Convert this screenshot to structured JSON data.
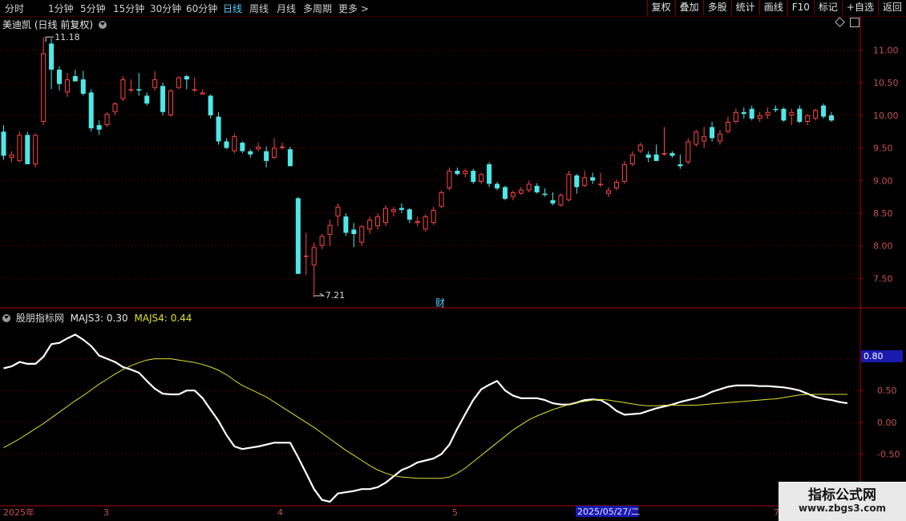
{
  "toolbar": {
    "periods": [
      "分时",
      "1分钟",
      "5分钟",
      "15分钟",
      "30分钟",
      "60分钟",
      "日线",
      "周线",
      "月线",
      "多周期",
      "更多 >"
    ],
    "active_period": "日线",
    "right_buttons": [
      "复权",
      "叠加",
      "多股",
      "统计",
      "画线",
      "F10",
      "标记",
      "+自选",
      "返回"
    ]
  },
  "colors": {
    "up": "#ff4545",
    "down": "#4fe8e8",
    "line1": "#ffffff",
    "line2": "#e0e030",
    "grid": "#7a0000",
    "axis": "#b00000"
  },
  "stock": {
    "name": "美迪凯",
    "mode": "(日线 前复权)"
  },
  "main_annotations": {
    "high_label": "11.18",
    "low_label": "7.21",
    "event_marker": "财"
  },
  "indicator": {
    "name": "股朋指标网",
    "line1_label": "MAJS3:",
    "line1_value": "0.30",
    "line2_label": "MAJS4:",
    "line2_value": "0.44",
    "cursor_value": "0.80"
  },
  "date_axis": {
    "labels": [
      "2025年",
      "3",
      "4",
      "5",
      "7"
    ],
    "cursor_date": "2025/05/27/二"
  },
  "watermark": {
    "line1": "指标公式网",
    "line2": "www.zbgs3.com"
  },
  "chart_data": [
    {
      "type": "candlestick",
      "title": "美迪凯",
      "ylim": [
        7.1,
        11.3
      ],
      "yticks": [
        7.5,
        8.0,
        8.5,
        9.0,
        9.5,
        10.0,
        10.5,
        11.0
      ],
      "grid": true,
      "ohlc": [
        [
          9.75,
          9.85,
          9.32,
          9.38
        ],
        [
          9.35,
          9.45,
          9.28,
          9.4
        ],
        [
          9.3,
          9.75,
          9.28,
          9.7
        ],
        [
          9.7,
          9.75,
          9.25,
          9.25
        ],
        [
          9.25,
          9.72,
          9.2,
          9.7
        ],
        [
          9.9,
          11.2,
          9.85,
          10.95
        ],
        [
          11.1,
          11.18,
          10.4,
          10.7
        ],
        [
          10.7,
          10.75,
          10.38,
          10.48
        ],
        [
          10.35,
          10.65,
          10.28,
          10.55
        ],
        [
          10.6,
          10.7,
          10.52,
          10.52
        ],
        [
          10.55,
          10.68,
          10.3,
          10.33
        ],
        [
          10.35,
          10.4,
          9.75,
          9.8
        ],
        [
          9.85,
          9.92,
          9.7,
          9.78
        ],
        [
          9.85,
          10.05,
          9.82,
          10.02
        ],
        [
          10.05,
          10.2,
          10.0,
          10.18
        ],
        [
          10.25,
          10.6,
          10.22,
          10.55
        ],
        [
          10.4,
          10.55,
          10.35,
          10.4
        ],
        [
          10.4,
          10.65,
          10.3,
          10.38
        ],
        [
          10.3,
          10.35,
          10.15,
          10.18
        ],
        [
          10.42,
          10.68,
          10.38,
          10.55
        ],
        [
          10.45,
          10.5,
          10.0,
          10.05
        ],
        [
          10.0,
          10.4,
          9.98,
          10.38
        ],
        [
          10.42,
          10.6,
          10.4,
          10.58
        ],
        [
          10.6,
          10.62,
          10.4,
          10.55
        ],
        [
          10.38,
          10.58,
          10.35,
          10.4
        ],
        [
          10.32,
          10.4,
          10.32,
          10.35
        ],
        [
          10.3,
          10.32,
          9.95,
          10.0
        ],
        [
          9.98,
          10.05,
          9.55,
          9.6
        ],
        [
          9.6,
          9.65,
          9.48,
          9.5
        ],
        [
          9.45,
          9.72,
          9.42,
          9.68
        ],
        [
          9.58,
          9.6,
          9.42,
          9.45
        ],
        [
          9.45,
          9.48,
          9.35,
          9.4
        ],
        [
          9.48,
          9.58,
          9.45,
          9.52
        ],
        [
          9.45,
          9.52,
          9.2,
          9.3
        ],
        [
          9.35,
          9.65,
          9.33,
          9.5
        ],
        [
          9.5,
          9.58,
          9.48,
          9.52
        ],
        [
          9.48,
          9.52,
          9.22,
          9.22
        ],
        [
          8.73,
          8.75,
          7.57,
          7.57
        ],
        [
          7.85,
          8.2,
          7.55,
          7.85
        ],
        [
          7.7,
          8.05,
          7.21,
          7.98
        ],
        [
          8.0,
          8.18,
          7.95,
          8.15
        ],
        [
          8.17,
          8.4,
          8.0,
          8.32
        ],
        [
          8.45,
          8.65,
          8.3,
          8.6
        ],
        [
          8.45,
          8.5,
          8.15,
          8.2
        ],
        [
          8.25,
          8.35,
          7.98,
          8.18
        ],
        [
          8.05,
          8.32,
          8.0,
          8.3
        ],
        [
          8.25,
          8.45,
          8.18,
          8.4
        ],
        [
          8.3,
          8.5,
          8.25,
          8.45
        ],
        [
          8.35,
          8.62,
          8.3,
          8.58
        ],
        [
          8.52,
          8.6,
          8.45,
          8.56
        ],
        [
          8.58,
          8.65,
          8.5,
          8.55
        ],
        [
          8.56,
          8.58,
          8.35,
          8.4
        ],
        [
          8.35,
          8.45,
          8.3,
          8.38
        ],
        [
          8.25,
          8.48,
          8.22,
          8.45
        ],
        [
          8.35,
          8.6,
          8.32,
          8.55
        ],
        [
          8.6,
          8.85,
          8.58,
          8.82
        ],
        [
          8.88,
          9.2,
          8.85,
          9.15
        ],
        [
          9.15,
          9.2,
          9.08,
          9.1
        ],
        [
          9.1,
          9.18,
          9.05,
          9.15
        ],
        [
          9.15,
          9.18,
          8.95,
          8.98
        ],
        [
          8.98,
          9.12,
          8.95,
          9.1
        ],
        [
          9.25,
          9.28,
          8.9,
          8.95
        ],
        [
          8.95,
          8.98,
          8.85,
          8.88
        ],
        [
          8.9,
          8.92,
          8.7,
          8.72
        ],
        [
          8.75,
          8.85,
          8.7,
          8.82
        ],
        [
          8.8,
          8.9,
          8.78,
          8.86
        ],
        [
          8.85,
          9.0,
          8.82,
          8.95
        ],
        [
          8.92,
          8.96,
          8.8,
          8.82
        ],
        [
          8.8,
          8.88,
          8.75,
          8.78
        ],
        [
          8.7,
          8.82,
          8.62,
          8.65
        ],
        [
          8.62,
          8.8,
          8.6,
          8.78
        ],
        [
          8.7,
          9.15,
          8.68,
          9.1
        ],
        [
          9.08,
          9.1,
          8.8,
          8.9
        ],
        [
          8.92,
          9.15,
          8.9,
          9.05
        ],
        [
          9.05,
          9.12,
          8.95,
          9.0
        ],
        [
          8.95,
          9.12,
          8.9,
          8.95
        ],
        [
          8.8,
          8.9,
          8.75,
          8.85
        ],
        [
          8.88,
          9.02,
          8.85,
          8.98
        ],
        [
          8.98,
          9.3,
          8.95,
          9.25
        ],
        [
          9.25,
          9.45,
          9.22,
          9.4
        ],
        [
          9.45,
          9.58,
          9.42,
          9.55
        ],
        [
          9.4,
          9.45,
          9.28,
          9.35
        ],
        [
          9.4,
          9.55,
          9.3,
          9.3
        ],
        [
          9.4,
          9.82,
          9.38,
          9.42
        ],
        [
          9.42,
          9.45,
          9.35,
          9.38
        ],
        [
          9.25,
          9.4,
          9.18,
          9.22
        ],
        [
          9.28,
          9.65,
          9.25,
          9.6
        ],
        [
          9.55,
          9.78,
          9.52,
          9.75
        ],
        [
          9.6,
          9.82,
          9.5,
          9.68
        ],
        [
          9.82,
          9.9,
          9.6,
          9.65
        ],
        [
          9.6,
          9.78,
          9.55,
          9.72
        ],
        [
          9.75,
          9.98,
          9.72,
          9.9
        ],
        [
          9.9,
          10.1,
          9.88,
          10.05
        ],
        [
          10.05,
          10.12,
          9.95,
          10.02
        ],
        [
          10.1,
          10.15,
          9.92,
          9.95
        ],
        [
          9.95,
          10.05,
          9.9,
          10.0
        ],
        [
          10.0,
          10.12,
          9.95,
          10.05
        ],
        [
          10.1,
          10.15,
          10.05,
          10.08
        ],
        [
          10.1,
          10.12,
          9.9,
          9.92
        ],
        [
          10.0,
          10.1,
          9.85,
          10.05
        ],
        [
          10.1,
          10.15,
          9.88,
          9.9
        ],
        [
          9.9,
          10.02,
          9.85,
          10.0
        ],
        [
          9.95,
          10.1,
          9.92,
          10.08
        ],
        [
          10.15,
          10.18,
          9.95,
          9.98
        ],
        [
          10.0,
          10.05,
          9.9,
          9.92
        ]
      ]
    },
    {
      "type": "line",
      "title": "股朋指标网",
      "ylim": [
        -1.3,
        1.6
      ],
      "yticks": [
        -0.5,
        0.0,
        0.5,
        1.0
      ],
      "grid": true,
      "series": [
        {
          "name": "MAJS3",
          "values": [
            0.85,
            0.88,
            0.95,
            0.92,
            0.92,
            1.03,
            1.23,
            1.25,
            1.32,
            1.38,
            1.3,
            1.2,
            1.05,
            1.0,
            0.95,
            0.87,
            0.83,
            0.78,
            0.65,
            0.53,
            0.45,
            0.44,
            0.44,
            0.5,
            0.5,
            0.38,
            0.2,
            0.02,
            -0.2,
            -0.38,
            -0.42,
            -0.4,
            -0.38,
            -0.35,
            -0.32,
            -0.32,
            -0.32,
            -0.55,
            -0.8,
            -1.05,
            -1.22,
            -1.25,
            -1.12,
            -1.1,
            -1.08,
            -1.05,
            -1.05,
            -1.02,
            -0.95,
            -0.85,
            -0.75,
            -0.7,
            -0.63,
            -0.6,
            -0.57,
            -0.5,
            -0.35,
            -0.1,
            0.13,
            0.35,
            0.52,
            0.59,
            0.65,
            0.5,
            0.42,
            0.38,
            0.38,
            0.38,
            0.35,
            0.3,
            0.28,
            0.28,
            0.31,
            0.35,
            0.36,
            0.35,
            0.28,
            0.18,
            0.12,
            0.13,
            0.14,
            0.18,
            0.22,
            0.25,
            0.28,
            0.32,
            0.35,
            0.38,
            0.42,
            0.48,
            0.52,
            0.56,
            0.58,
            0.58,
            0.58,
            0.57,
            0.57,
            0.56,
            0.55,
            0.53,
            0.5,
            0.45,
            0.4,
            0.37,
            0.35,
            0.32,
            0.3
          ]
        },
        {
          "name": "MAJS4",
          "values": [
            -0.4,
            -0.33,
            -0.26,
            -0.18,
            -0.1,
            -0.02,
            0.07,
            0.16,
            0.25,
            0.34,
            0.42,
            0.51,
            0.6,
            0.68,
            0.76,
            0.83,
            0.89,
            0.94,
            0.98,
            1.0,
            1.0,
            1.0,
            0.98,
            0.96,
            0.94,
            0.91,
            0.87,
            0.82,
            0.75,
            0.66,
            0.58,
            0.52,
            0.46,
            0.4,
            0.32,
            0.24,
            0.16,
            0.08,
            0.0,
            -0.08,
            -0.17,
            -0.26,
            -0.35,
            -0.44,
            -0.52,
            -0.6,
            -0.68,
            -0.75,
            -0.8,
            -0.84,
            -0.86,
            -0.87,
            -0.88,
            -0.88,
            -0.88,
            -0.88,
            -0.86,
            -0.8,
            -0.72,
            -0.62,
            -0.52,
            -0.42,
            -0.32,
            -0.22,
            -0.12,
            -0.04,
            0.04,
            0.1,
            0.15,
            0.2,
            0.24,
            0.28,
            0.31,
            0.33,
            0.35,
            0.36,
            0.35,
            0.33,
            0.31,
            0.29,
            0.27,
            0.26,
            0.26,
            0.27,
            0.27,
            0.27,
            0.27,
            0.27,
            0.28,
            0.29,
            0.3,
            0.31,
            0.32,
            0.33,
            0.34,
            0.35,
            0.36,
            0.37,
            0.39,
            0.41,
            0.43,
            0.44,
            0.44,
            0.44,
            0.44,
            0.44,
            0.44
          ]
        }
      ]
    }
  ]
}
